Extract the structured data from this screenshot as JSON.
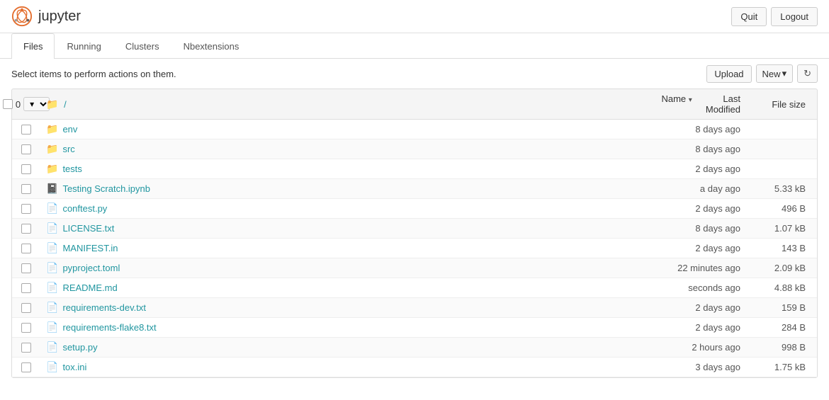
{
  "header": {
    "logo_alt": "Jupyter Logo",
    "app_name": "jupyter",
    "quit_label": "Quit",
    "logout_label": "Logout"
  },
  "tabs": [
    {
      "id": "files",
      "label": "Files",
      "active": true
    },
    {
      "id": "running",
      "label": "Running",
      "active": false
    },
    {
      "id": "clusters",
      "label": "Clusters",
      "active": false
    },
    {
      "id": "nbextensions",
      "label": "Nbextensions",
      "active": false
    }
  ],
  "toolbar": {
    "select_message": "Select items to perform actions on them.",
    "upload_label": "Upload",
    "new_label": "New",
    "new_arrow": "▾",
    "refresh_icon": "↻"
  },
  "file_list": {
    "select_all_count": "0",
    "breadcrumb": "/",
    "columns": {
      "name_label": "Name",
      "name_sort": "▾",
      "modified_label": "Last Modified",
      "size_label": "File size"
    },
    "items": [
      {
        "id": "env",
        "name": "env",
        "type": "folder",
        "modified": "8 days ago",
        "size": ""
      },
      {
        "id": "src",
        "name": "src",
        "type": "folder",
        "modified": "8 days ago",
        "size": ""
      },
      {
        "id": "tests",
        "name": "tests",
        "type": "folder",
        "modified": "2 days ago",
        "size": ""
      },
      {
        "id": "testing-scratch",
        "name": "Testing Scratch.ipynb",
        "type": "notebook",
        "modified": "a day ago",
        "size": "5.33 kB"
      },
      {
        "id": "conftest",
        "name": "conftest.py",
        "type": "file",
        "modified": "2 days ago",
        "size": "496 B"
      },
      {
        "id": "license",
        "name": "LICENSE.txt",
        "type": "file",
        "modified": "8 days ago",
        "size": "1.07 kB"
      },
      {
        "id": "manifest",
        "name": "MANIFEST.in",
        "type": "file",
        "modified": "2 days ago",
        "size": "143 B"
      },
      {
        "id": "pyproject",
        "name": "pyproject.toml",
        "type": "file",
        "modified": "22 minutes ago",
        "size": "2.09 kB"
      },
      {
        "id": "readme",
        "name": "README.md",
        "type": "file",
        "modified": "seconds ago",
        "size": "4.88 kB"
      },
      {
        "id": "requirements-dev",
        "name": "requirements-dev.txt",
        "type": "file",
        "modified": "2 days ago",
        "size": "159 B"
      },
      {
        "id": "requirements-flake8",
        "name": "requirements-flake8.txt",
        "type": "file",
        "modified": "2 days ago",
        "size": "284 B"
      },
      {
        "id": "setup",
        "name": "setup.py",
        "type": "file",
        "modified": "2 hours ago",
        "size": "998 B"
      },
      {
        "id": "tox",
        "name": "tox.ini",
        "type": "file",
        "modified": "3 days ago",
        "size": "1.75 kB"
      }
    ]
  }
}
